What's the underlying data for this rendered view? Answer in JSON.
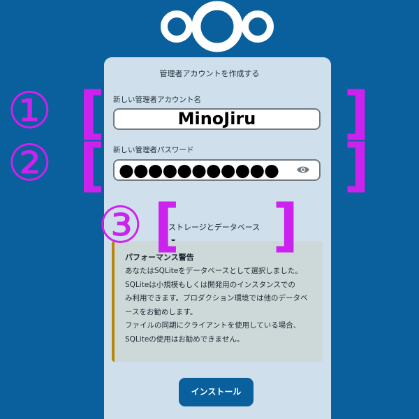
{
  "colors": {
    "background": "#0a5f9d",
    "card": "#cfe0ec",
    "annotation": "#cc22ee",
    "warning_border": "#b8860b",
    "button": "#0a5f9d"
  },
  "logo": {
    "icon": "nextcloud-logo"
  },
  "form": {
    "title": "管理者アカウントを作成する",
    "username_label": "新しい管理者アカウント名",
    "username_value": "MinoJiru",
    "password_label": "新しい管理者パスワード",
    "password_value": "●●●●●●●●●●●",
    "show_password_icon": "eye-icon",
    "storage_toggle": "ストレージとデータベース",
    "install_button": "インストール"
  },
  "warning": {
    "title": "パフォーマンス警告",
    "lines": [
      "あなたはSQLiteをデータベースとして選択しました。",
      "SQLiteは小規模もしくは開発用のインスタンスでの",
      "み利用できます。プロダクション環境では他のデータベ",
      "ースをお勧めします。",
      "ファイルの同期にクライアントを使用している場合、",
      "SQLiteの使用はお勧めできません。"
    ]
  },
  "annotations": {
    "one": "①",
    "two": "②",
    "three": "③",
    "bracket_open": "[",
    "bracket_close": "]"
  }
}
